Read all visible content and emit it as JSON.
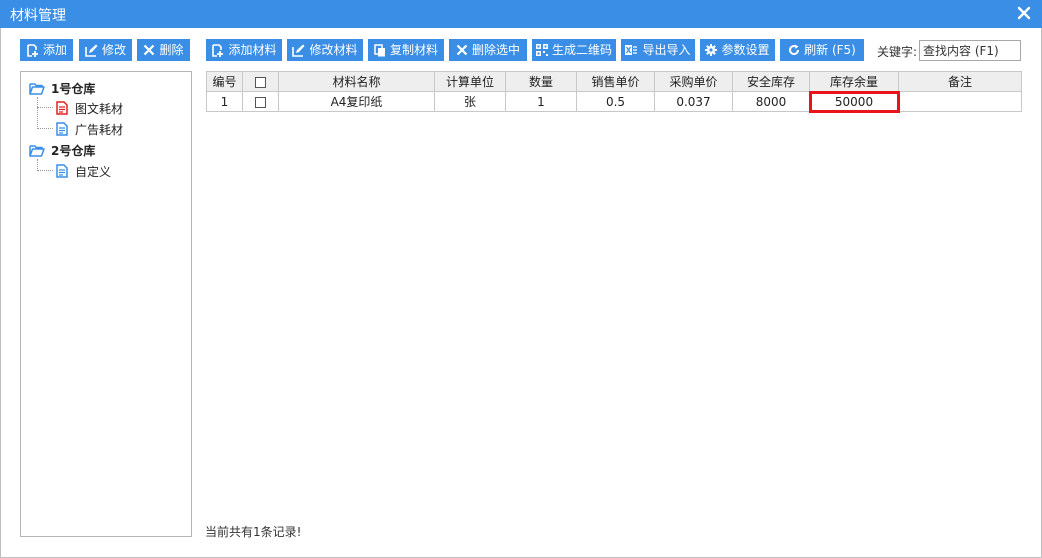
{
  "window": {
    "title": "材料管理"
  },
  "toolbar_left": {
    "add": "添加",
    "edit": "修改",
    "delete": "删除"
  },
  "toolbar": {
    "add_material": "添加材料",
    "edit_material": "修改材料",
    "copy_material": "复制材料",
    "delete_selected": "删除选中",
    "gen_qrcode": "生成二维码",
    "export_import": "导出导入",
    "settings": "参数设置",
    "refresh": "刷新 (F5)"
  },
  "search": {
    "label": "关键字:",
    "value": "查找内容 (F1)"
  },
  "tree": {
    "warehouses": [
      {
        "name": "1号仓库",
        "children": [
          "图文耗材",
          "广告耗材"
        ]
      },
      {
        "name": "2号仓库",
        "children": [
          "自定义"
        ]
      }
    ]
  },
  "table": {
    "headers": [
      "编号",
      "",
      "材料名称",
      "计算单位",
      "数量",
      "销售单价",
      "采购单价",
      "安全库存",
      "库存余量",
      "备注"
    ],
    "rows": [
      {
        "id": "1",
        "name": "A4复印纸",
        "unit": "张",
        "qty": "1",
        "sale_price": "0.5",
        "purchase_price": "0.037",
        "safety_stock": "8000",
        "stock_remaining": "50000",
        "remark": ""
      }
    ]
  },
  "status": "当前共有1条记录!",
  "colors": {
    "accent": "#3a8ee6",
    "highlight": "#e8141a",
    "folder": "#3a8ee6",
    "doc_red": "#e02020",
    "doc_blue": "#3a8ee6"
  }
}
